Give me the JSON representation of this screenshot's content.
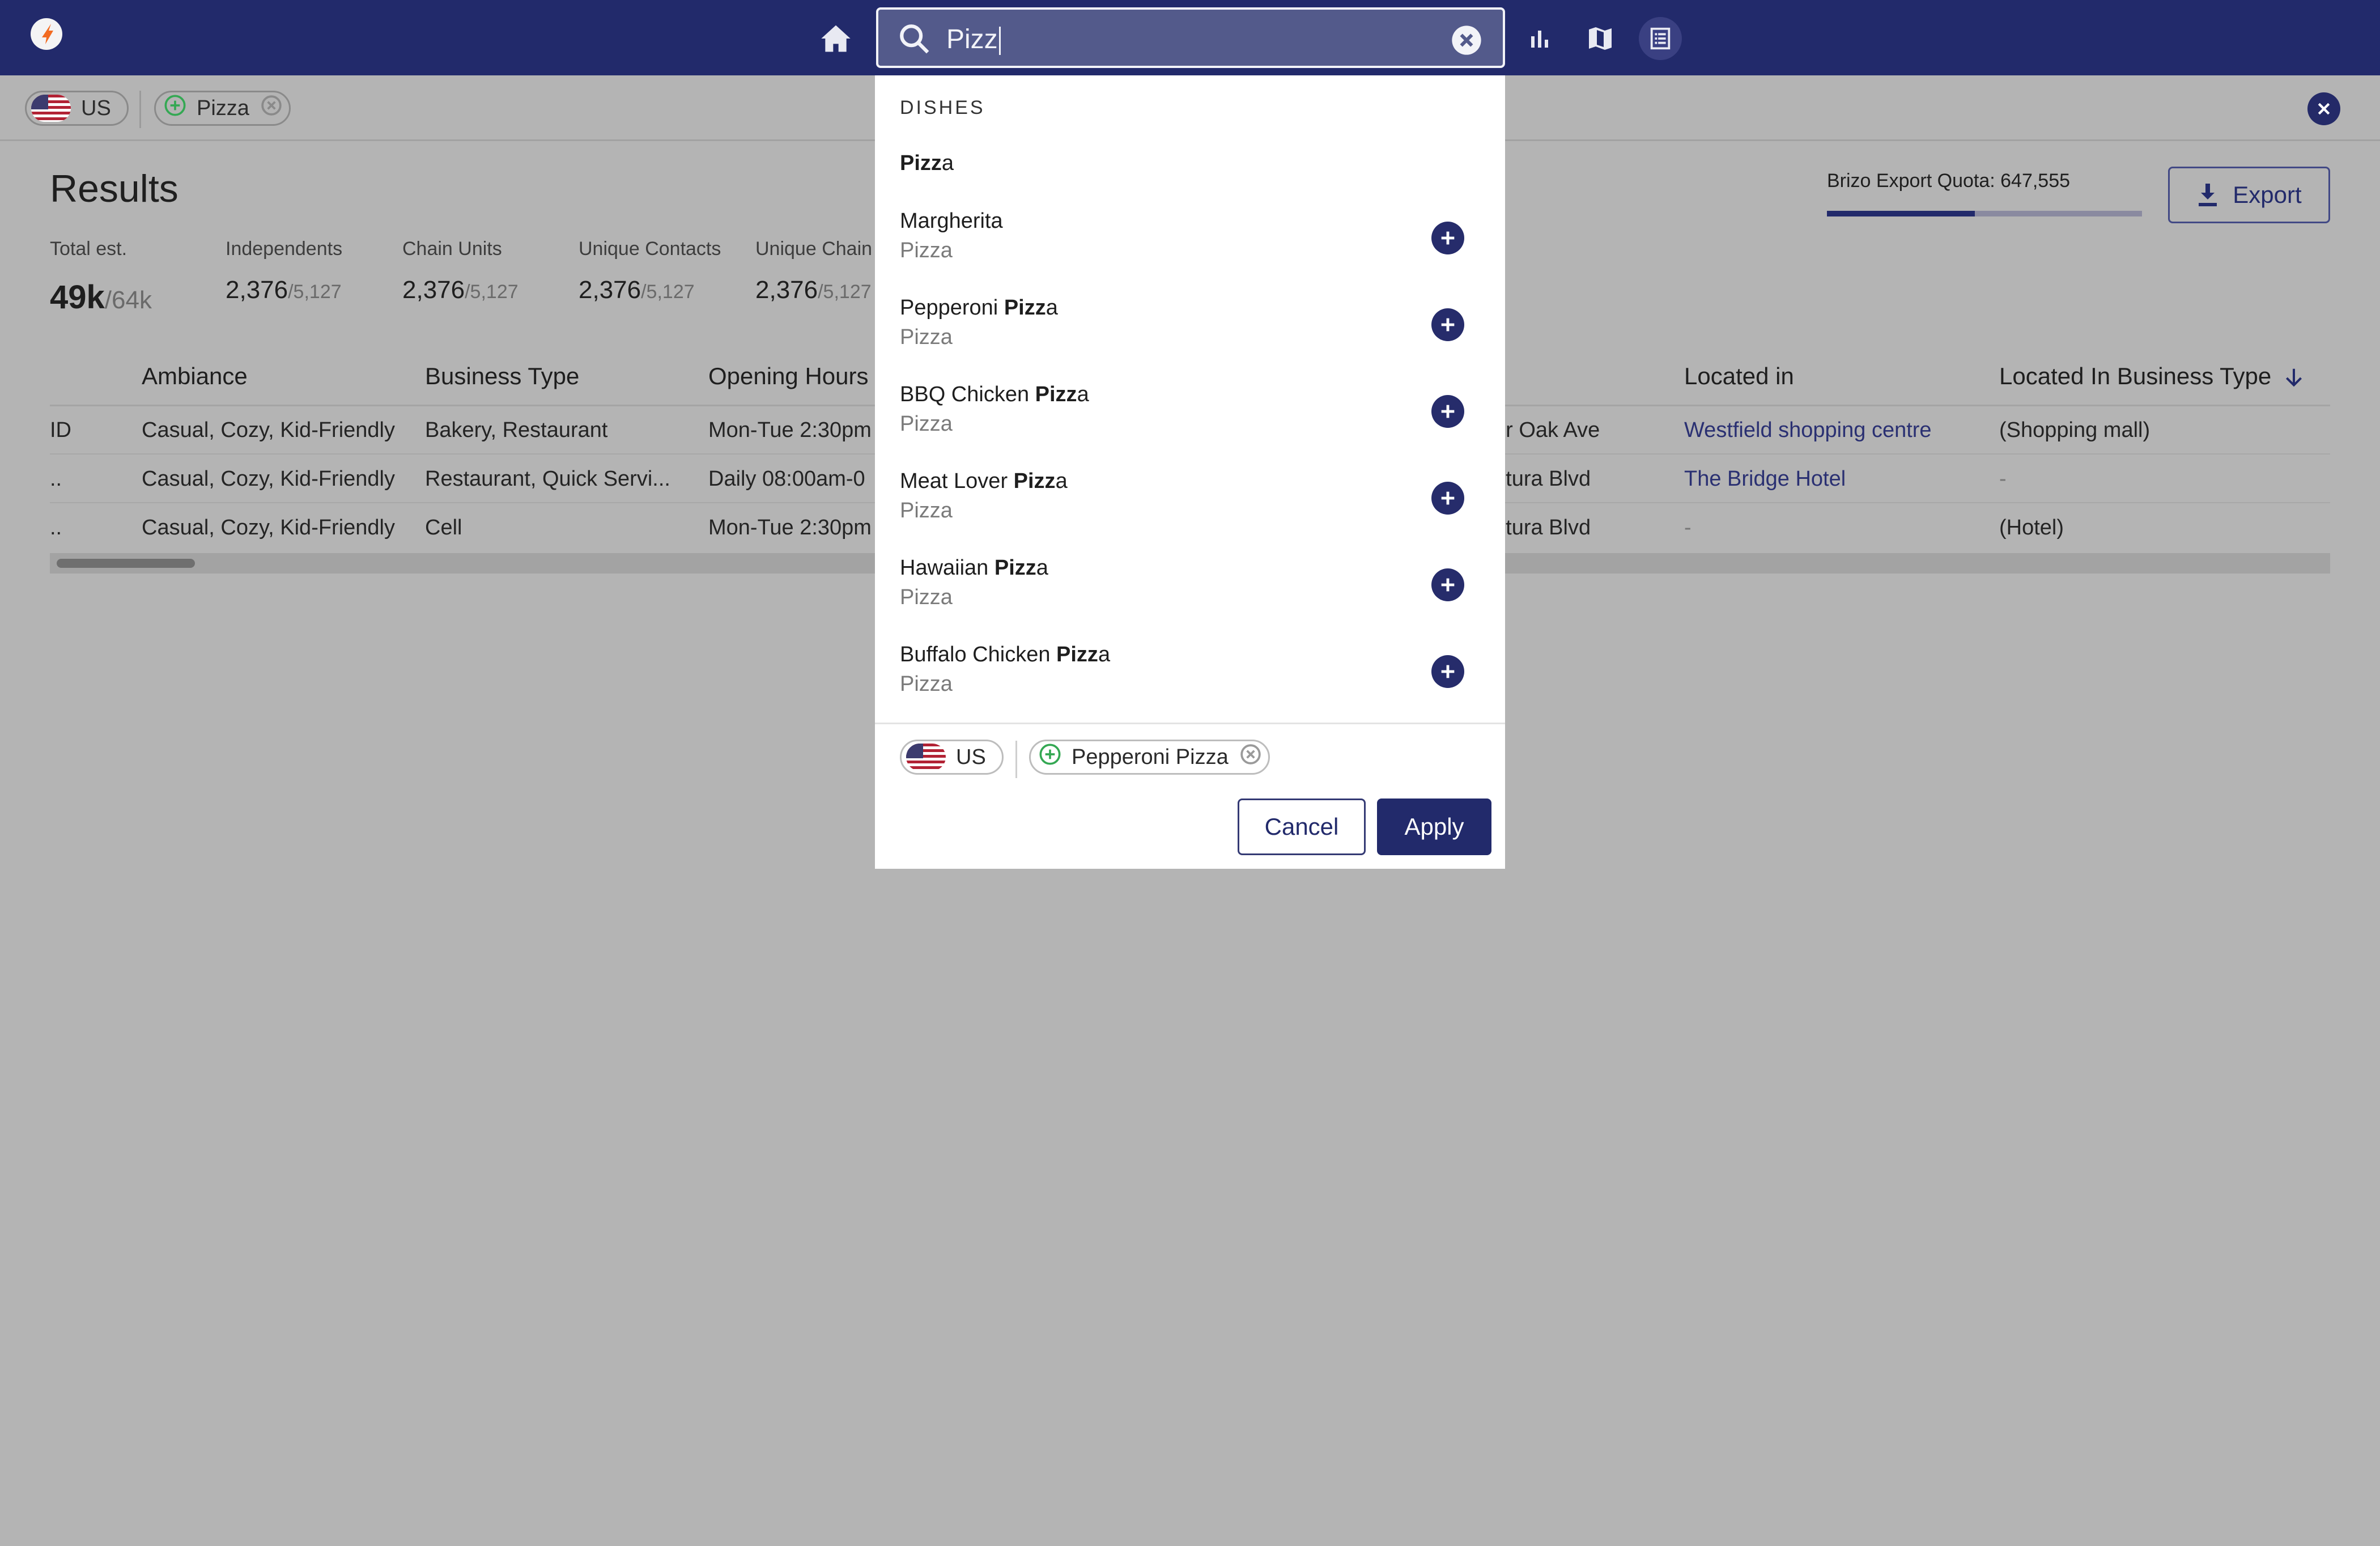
{
  "colors": {
    "brand": "#222a6b",
    "background": "#b4b4b4",
    "panel": "#ffffff",
    "chip_plus": "#34a853",
    "accent_orange": "#f26b21"
  },
  "topbar": {
    "icons": [
      "logo-icon",
      "home-icon",
      "bar-chart-icon",
      "map-icon",
      "list-view-icon"
    ],
    "search": {
      "value": "Pizz",
      "clear_icon": "clear-circle-icon"
    }
  },
  "filters": {
    "country": "US",
    "chips": [
      {
        "label": "Pizza"
      }
    ]
  },
  "results": {
    "title": "Results",
    "stats": [
      {
        "label": "Total est.",
        "value": "49k",
        "sub": "/64k"
      },
      {
        "label": "Independents",
        "value": "2,376",
        "sub": "/5,127"
      },
      {
        "label": "Chain Units",
        "value": "2,376",
        "sub": "/5,127"
      },
      {
        "label": "Unique Contacts",
        "value": "2,376",
        "sub": "/5,127"
      },
      {
        "label": "Unique Chain",
        "value": "2,376",
        "sub": "/5,127"
      }
    ],
    "quota": {
      "label": "Brizo Export Quota: 647,555",
      "fill_fraction": 0.47
    },
    "export_label": "Export",
    "table": {
      "headers": [
        "Ambiance",
        "Business Type",
        "Opening Hours",
        "Located in",
        "Located In Business Type"
      ],
      "rows": [
        {
          "id": "ID",
          "ambiance": "Casual, Cozy, Kid-Friendly",
          "business_type": "Bakery, Restaurant",
          "hours": "Mon-Tue 2:30pm",
          "address": "er Oak Ave",
          "located_in": "Westfield shopping centre",
          "located_type": "(Shopping mall)"
        },
        {
          "id": "..",
          "ambiance": "Casual, Cozy, Kid-Friendly",
          "business_type": "Restaurant, Quick Servi...",
          "hours": "Daily 08:00am-0",
          "address": "ntura Blvd",
          "located_in": "The Bridge Hotel",
          "located_type": "-"
        },
        {
          "id": "..",
          "ambiance": "Casual, Cozy, Kid-Friendly",
          "business_type": "Cell",
          "hours": "Mon-Tue 2:30pm",
          "address": "ntura Blvd",
          "located_in": "-",
          "located_type": "(Hotel)"
        }
      ]
    }
  },
  "dropdown": {
    "section": "DISHES",
    "top_option": {
      "match": "Pizz",
      "rest": "a"
    },
    "options": [
      {
        "title_pre": "Margherita",
        "match": "",
        "title_post": "",
        "sub": "Pizza"
      },
      {
        "title_pre": "Pepperoni ",
        "match": "Pizz",
        "title_post": "a",
        "sub": "Pizza"
      },
      {
        "title_pre": "BBQ Chicken ",
        "match": "Pizz",
        "title_post": "a",
        "sub": "Pizza"
      },
      {
        "title_pre": "Meat Lover ",
        "match": "Pizz",
        "title_post": "a",
        "sub": "Pizza"
      },
      {
        "title_pre": "Hawaiian ",
        "match": "Pizz",
        "title_post": "a",
        "sub": "Pizza"
      },
      {
        "title_pre": "Buffalo Chicken ",
        "match": "Pizz",
        "title_post": "a",
        "sub": "Pizza"
      }
    ],
    "selected": {
      "country": "US",
      "chip": "Pepperoni Pizza"
    },
    "cancel_label": "Cancel",
    "apply_label": "Apply"
  }
}
